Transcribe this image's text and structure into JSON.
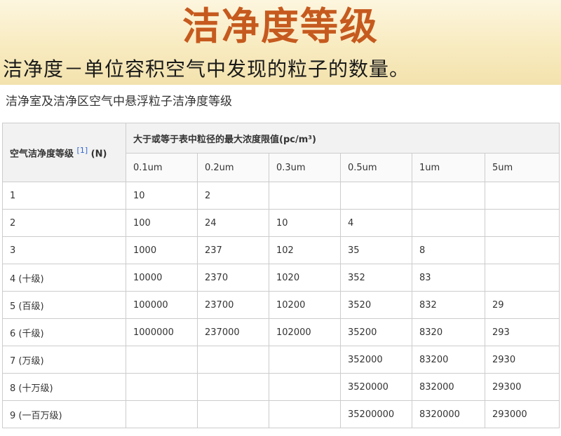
{
  "title": "洁净度等级",
  "definition": "洁净度－单位容积空气中发现的粒子的数量。",
  "table": {
    "caption": "洁净室及洁净区空气中悬浮粒子洁净度等级",
    "grade_header": "空气洁净度等级",
    "footnote": "[1]",
    "grade_suffix": "(N)",
    "limit_header": "大于或等于表中粒径的最大浓度限值(pc/m³)",
    "sizes": [
      "0.1um",
      "0.2um",
      "0.3um",
      "0.5um",
      "1um",
      "5um"
    ],
    "rows": [
      {
        "grade": "1",
        "values": [
          "10",
          "2",
          "",
          "",
          "",
          ""
        ]
      },
      {
        "grade": "2",
        "values": [
          "100",
          "24",
          "10",
          "4",
          "",
          ""
        ]
      },
      {
        "grade": "3",
        "values": [
          "1000",
          "237",
          "102",
          "35",
          "8",
          ""
        ]
      },
      {
        "grade": "4 (十级)",
        "values": [
          "10000",
          "2370",
          "1020",
          "352",
          "83",
          ""
        ]
      },
      {
        "grade": "5 (百级)",
        "values": [
          "100000",
          "23700",
          "10200",
          "3520",
          "832",
          "29"
        ]
      },
      {
        "grade": "6 (千级)",
        "values": [
          "1000000",
          "237000",
          "102000",
          "35200",
          "8320",
          "293"
        ]
      },
      {
        "grade": "7 (万级)",
        "values": [
          "",
          "",
          "",
          "352000",
          "83200",
          "2930"
        ]
      },
      {
        "grade": "8 (十万级)",
        "values": [
          "",
          "",
          "",
          "3520000",
          "832000",
          "29300"
        ]
      },
      {
        "grade": "9 (一百万级)",
        "values": [
          "",
          "",
          "",
          "35200000",
          "8320000",
          "293000"
        ]
      }
    ]
  }
}
